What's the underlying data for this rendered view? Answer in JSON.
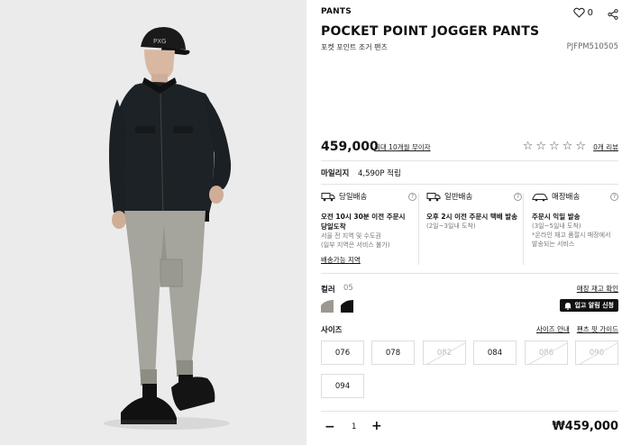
{
  "product": {
    "category": "PANTS",
    "likes": "0",
    "title": "POCKET POINT JOGGER PANTS",
    "subtitle": "포켓 포인트 조거 팬츠",
    "code": "PJFPM510505",
    "price": "459,000",
    "installment": "최대 10개월 무이자",
    "rating_stars": 0,
    "reviews": "0개 리뷰"
  },
  "mileage": {
    "label": "마일리지",
    "value": "4,590P 적립"
  },
  "shipping": {
    "options": [
      {
        "icon": "same-day-truck-icon",
        "title": "당일배송",
        "main": [
          "오전 10시 30분 이전 주문시",
          "당일도착"
        ],
        "sub": [
          "서울 전 지역 및 수도권",
          "(일부 지역은 서비스 불가)"
        ]
      },
      {
        "icon": "truck-icon",
        "title": "일반배송",
        "main": [
          "오후 2시 이전 주문시 택배 발송"
        ],
        "sub": [
          "(2일~3일내 도착)"
        ]
      },
      {
        "icon": "store-car-icon",
        "title": "매장배송",
        "main": [
          "주문시 익일 발송"
        ],
        "sub": [
          "(3일~5일내 도착)",
          "*온라인 재고 품절시 매장에서",
          "발송되는 서비스"
        ]
      }
    ],
    "area_link": "배송가능 지역"
  },
  "color": {
    "label": "컬러",
    "code": "05",
    "stock_link": "매장 재고 확인",
    "swatches": [
      "#9a9890",
      "#111111"
    ],
    "alert_button": "입고 알림 신청"
  },
  "size": {
    "label": "사이즈",
    "guide_link": "사이즈 안내",
    "fit_link": "팬츠 핏 가이드",
    "options": [
      {
        "label": "076",
        "available": true
      },
      {
        "label": "078",
        "available": true
      },
      {
        "label": "082",
        "available": false
      },
      {
        "label": "084",
        "available": true
      },
      {
        "label": "086",
        "available": false
      },
      {
        "label": "090",
        "available": false
      },
      {
        "label": "094",
        "available": true
      }
    ]
  },
  "quantity": {
    "minus": "−",
    "value": "1",
    "plus": "+"
  },
  "total": "₩459,000"
}
